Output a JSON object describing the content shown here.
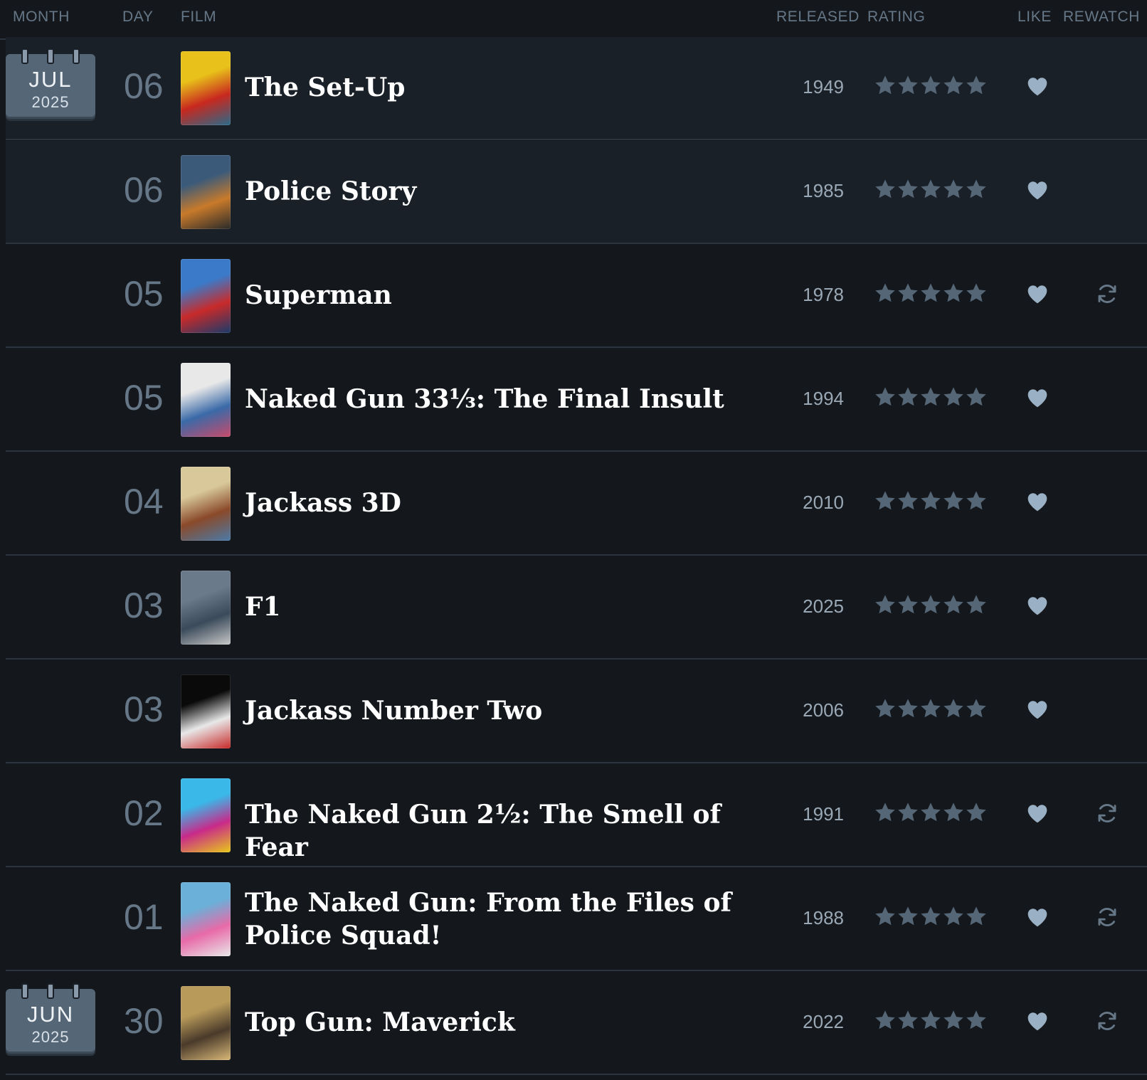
{
  "header": {
    "month": "Month",
    "day": "Day",
    "film": "Film",
    "released": "Released",
    "rating": "Rating",
    "like": "Like",
    "rewatch": "Rewatch"
  },
  "colors": {
    "background": "#14181c",
    "row_highlight": "#1a2027",
    "divider": "#2c3440",
    "calendar": "#556677",
    "star": "#556677",
    "heart": "#9ab0c4",
    "rewatch": "#667788"
  },
  "entries": [
    {
      "month": "JUL",
      "year": "2025",
      "day": "06",
      "title": "The Set-Up",
      "released": "1949",
      "stars": 5,
      "liked": true,
      "rewatch": false
    },
    {
      "month": "",
      "year": "",
      "day": "06",
      "title": "Police Story",
      "released": "1985",
      "stars": 5,
      "liked": true,
      "rewatch": false
    },
    {
      "month": "",
      "year": "",
      "day": "05",
      "title": "Superman",
      "released": "1978",
      "stars": 5,
      "liked": true,
      "rewatch": true
    },
    {
      "month": "",
      "year": "",
      "day": "05",
      "title": "Naked Gun 33⅓: The Final Insult",
      "released": "1994",
      "stars": 5,
      "liked": true,
      "rewatch": false
    },
    {
      "month": "",
      "year": "",
      "day": "04",
      "title": "Jackass 3D",
      "released": "2010",
      "stars": 5,
      "liked": true,
      "rewatch": false
    },
    {
      "month": "",
      "year": "",
      "day": "03",
      "title": "F1",
      "released": "2025",
      "stars": 5,
      "liked": true,
      "rewatch": false
    },
    {
      "month": "",
      "year": "",
      "day": "03",
      "title": "Jackass Number Two",
      "released": "2006",
      "stars": 5,
      "liked": true,
      "rewatch": false
    },
    {
      "month": "",
      "year": "",
      "day": "02",
      "title": "The Naked Gun 2½: The Smell of Fear",
      "released": "1991",
      "stars": 5,
      "liked": true,
      "rewatch": true
    },
    {
      "month": "",
      "year": "",
      "day": "01",
      "title": "The Naked Gun: From the Files of Police Squad!",
      "released": "1988",
      "stars": 5,
      "liked": true,
      "rewatch": true
    },
    {
      "month": "JUN",
      "year": "2025",
      "day": "30",
      "title": "Top Gun: Maverick",
      "released": "2022",
      "stars": 5,
      "liked": true,
      "rewatch": true
    }
  ]
}
